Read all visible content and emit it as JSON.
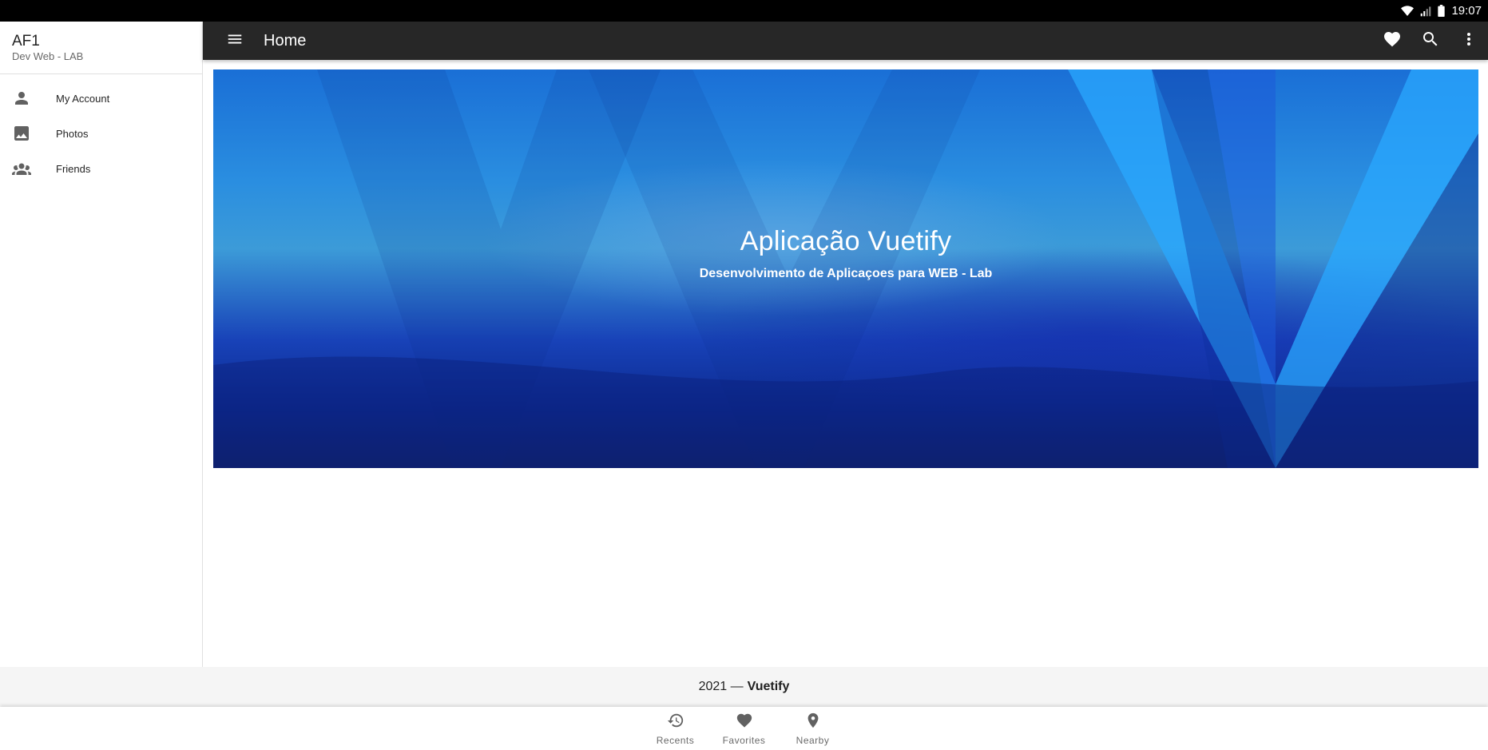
{
  "status_bar": {
    "time": "19:07"
  },
  "drawer": {
    "title": "AF1",
    "subtitle": "Dev Web - LAB",
    "items": [
      {
        "label": "My Account",
        "icon": "account-icon"
      },
      {
        "label": "Photos",
        "icon": "image-icon"
      },
      {
        "label": "Friends",
        "icon": "account-group-icon"
      }
    ]
  },
  "appbar": {
    "title": "Home",
    "actions": [
      "heart-icon",
      "search-icon",
      "more-vert-icon"
    ]
  },
  "hero": {
    "title": "Aplicação Vuetify",
    "subtitle": "Desenvolvimento de Aplicaçoes para WEB - Lab"
  },
  "footer": {
    "year": "2021 —",
    "brand": "Vuetify"
  },
  "bottom_nav": [
    {
      "label": "Recents",
      "icon": "history-icon"
    },
    {
      "label": "Favorites",
      "icon": "heart-icon"
    },
    {
      "label": "Nearby",
      "icon": "map-marker-icon"
    }
  ],
  "colors": {
    "appbar": "#272727",
    "footer": "#f5f5f5",
    "status_bar": "#000000"
  }
}
